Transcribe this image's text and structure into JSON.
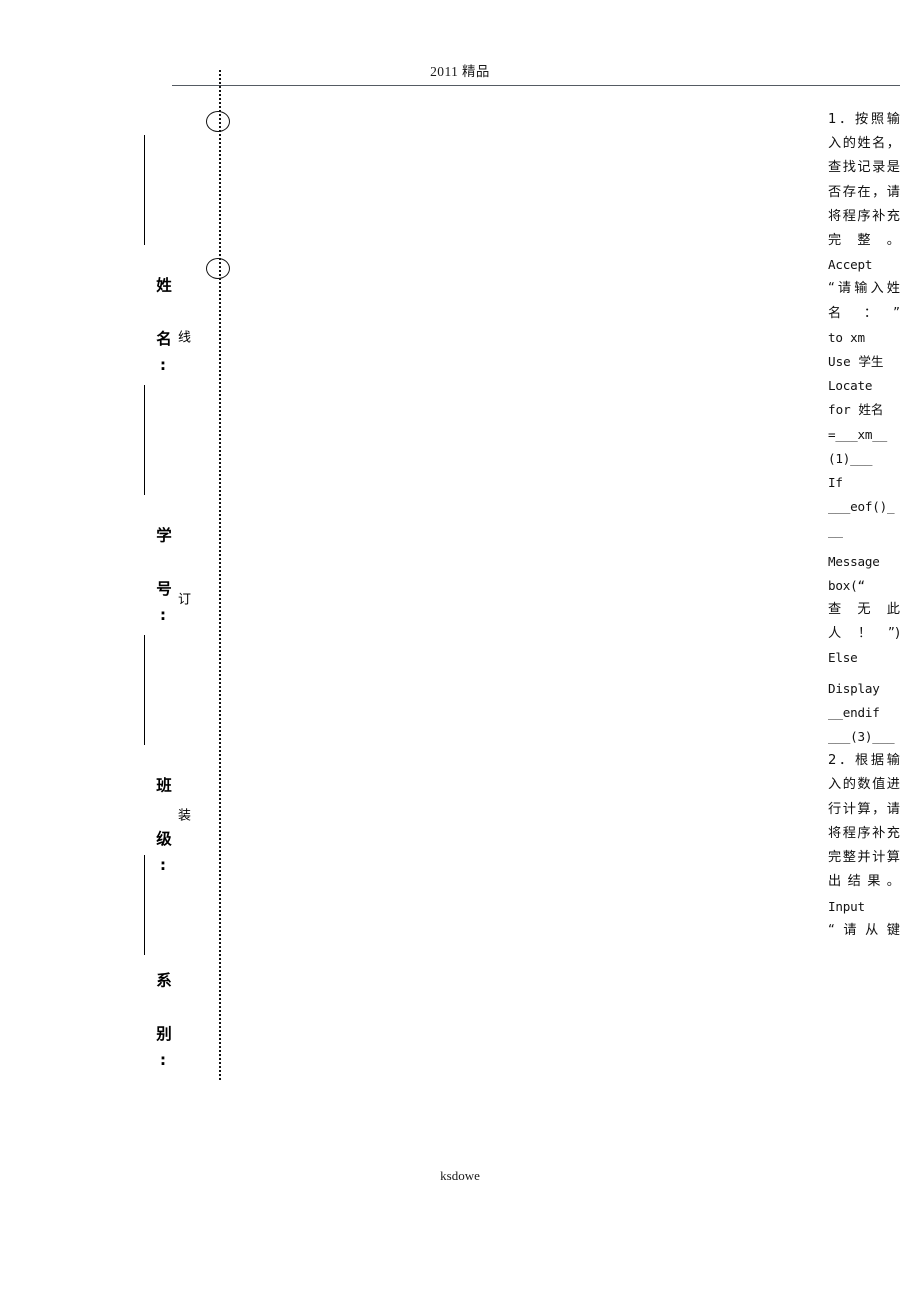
{
  "document": {
    "header": {
      "title": "2011 精品"
    },
    "footer": {
      "text": "ksdowe"
    },
    "binding_margin": {
      "seal_marks": [
        {
          "label": "线"
        },
        {
          "label": "订"
        },
        {
          "label": "装"
        }
      ],
      "fields": [
        {
          "label": "姓 名:"
        },
        {
          "label": "学 号:"
        },
        {
          "label": "班 级:"
        },
        {
          "label": "系 别:"
        }
      ]
    },
    "question_column": {
      "lines": [
        {
          "kind": "cn",
          "text": "1．按照输入的姓名，查找记录是否存在，请将程序补充完整。"
        },
        {
          "kind": "code",
          "text": "Accept"
        },
        {
          "kind": "cn",
          "text": "“请输入姓名：”"
        },
        {
          "kind": "code",
          "text": "to xm"
        },
        {
          "kind": "mix",
          "text": "Use 学生"
        },
        {
          "kind": "code",
          "text": "Locate"
        },
        {
          "kind": "mix",
          "text": "for 姓名"
        },
        {
          "kind": "code",
          "text": "=___xm__(1)___"
        },
        {
          "kind": "code",
          "text": "If"
        },
        {
          "kind": "code",
          "text": "___eof()___"
        },
        {
          "kind": "gap",
          "text": ""
        },
        {
          "kind": "code",
          "text": "Message"
        },
        {
          "kind": "code",
          "text": "box(“"
        },
        {
          "kind": "cn",
          "text": "查无此人！”)"
        },
        {
          "kind": "code",
          "text": "Else"
        },
        {
          "kind": "gap",
          "text": ""
        },
        {
          "kind": "code",
          "text": "Display"
        },
        {
          "kind": "code",
          "text": "__endif"
        },
        {
          "kind": "code",
          "text": "___(3)___"
        },
        {
          "kind": "cn",
          "text": "2．根据输入的数值进行计算，请将程序补充完整并计算出结果。"
        },
        {
          "kind": "code",
          "text": "Input"
        },
        {
          "kind": "cn",
          "text": "“请从键"
        }
      ]
    }
  },
  "colors": {
    "ink": "#111111",
    "rule": "#555b63",
    "paper": "#ffffff"
  }
}
